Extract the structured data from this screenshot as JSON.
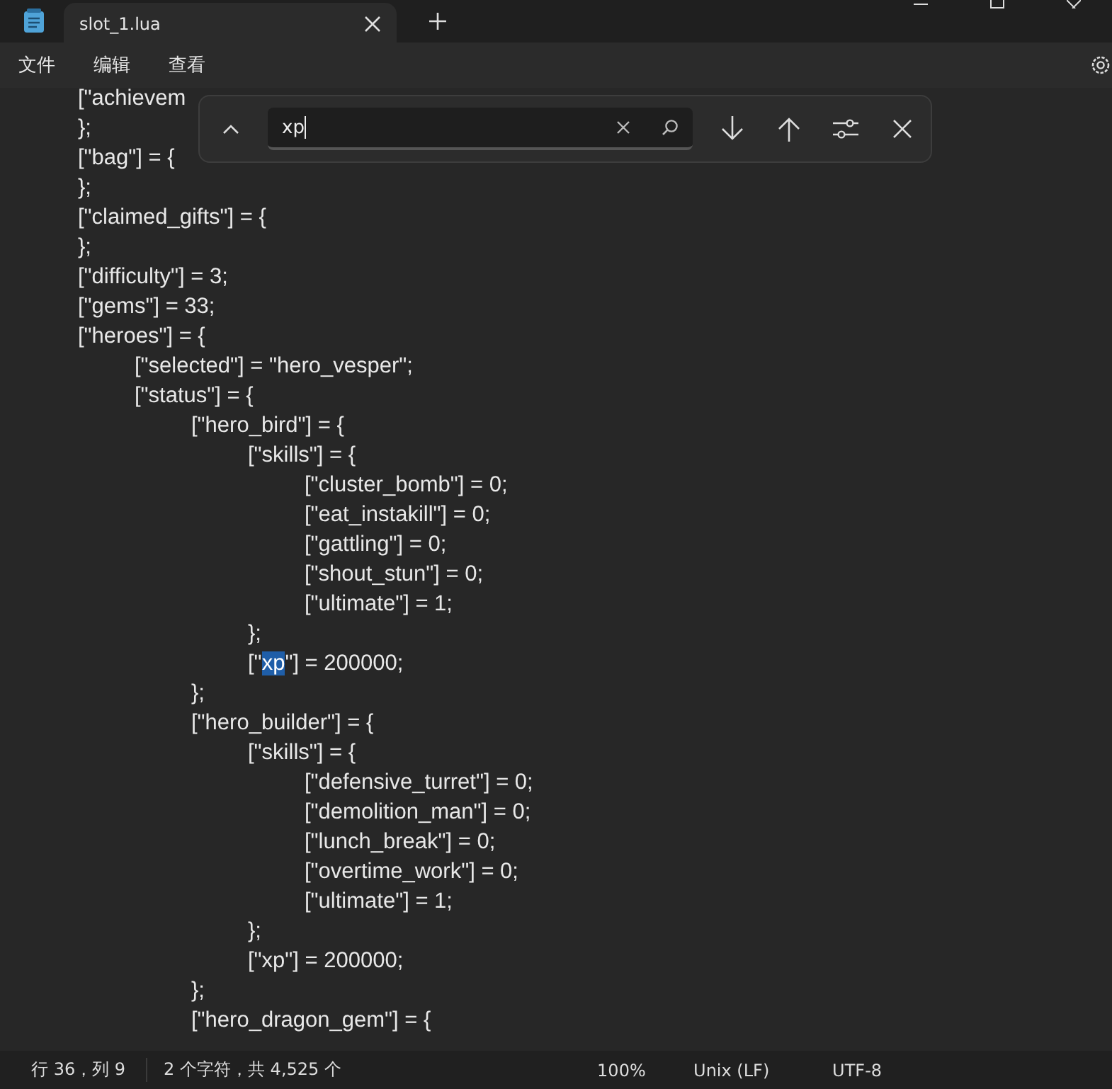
{
  "window": {
    "tab_title": "slot_1.lua"
  },
  "menu": [
    "文件",
    "编辑",
    "查看"
  ],
  "find": {
    "value": "xp"
  },
  "lines": [
    {
      "text": "[\"achievem"
    },
    {
      "text": "};"
    },
    {
      "text": "[\"bag\"] = {"
    },
    {
      "text": "};"
    },
    {
      "text": "[\"claimed_gifts\"] = {"
    },
    {
      "text": "};"
    },
    {
      "text": "[\"difficulty\"] = 3;"
    },
    {
      "text": "[\"gems\"] = 33;"
    },
    {
      "text": "[\"heroes\"] = {"
    },
    {
      "text": "\t[\"selected\"] = \"hero_vesper\";"
    },
    {
      "text": "\t[\"status\"] = {"
    },
    {
      "text": "\t\t[\"hero_bird\"] = {"
    },
    {
      "text": "\t\t\t[\"skills\"] = {"
    },
    {
      "text": "\t\t\t\t[\"cluster_bomb\"] = 0;"
    },
    {
      "text": "\t\t\t\t[\"eat_instakill\"] = 0;"
    },
    {
      "text": "\t\t\t\t[\"gattling\"] = 0;"
    },
    {
      "text": "\t\t\t\t[\"shout_stun\"] = 0;"
    },
    {
      "text": "\t\t\t\t[\"ultimate\"] = 1;"
    },
    {
      "text": "\t\t\t};"
    },
    {
      "text": "\t\t\t[\"",
      "match": "xp",
      "rest": "\"] = 200000;"
    },
    {
      "text": "\t\t};"
    },
    {
      "text": "\t\t[\"hero_builder\"] = {"
    },
    {
      "text": "\t\t\t[\"skills\"] = {"
    },
    {
      "text": "\t\t\t\t[\"defensive_turret\"] = 0;"
    },
    {
      "text": "\t\t\t\t[\"demolition_man\"] = 0;"
    },
    {
      "text": "\t\t\t\t[\"lunch_break\"] = 0;"
    },
    {
      "text": "\t\t\t\t[\"overtime_work\"] = 0;"
    },
    {
      "text": "\t\t\t\t[\"ultimate\"] = 1;"
    },
    {
      "text": "\t\t\t};"
    },
    {
      "text": "\t\t\t[\"xp\"] = 200000;"
    },
    {
      "text": "\t\t};"
    },
    {
      "text": "\t\t[\"hero_dragon_gem\"] = {"
    }
  ],
  "status_bar": {
    "position": "行 36，列 9",
    "selection": "2 个字符，共 4,525 个",
    "zoom": "100%",
    "line_ending": "Unix (LF)",
    "encoding": "UTF-8"
  }
}
